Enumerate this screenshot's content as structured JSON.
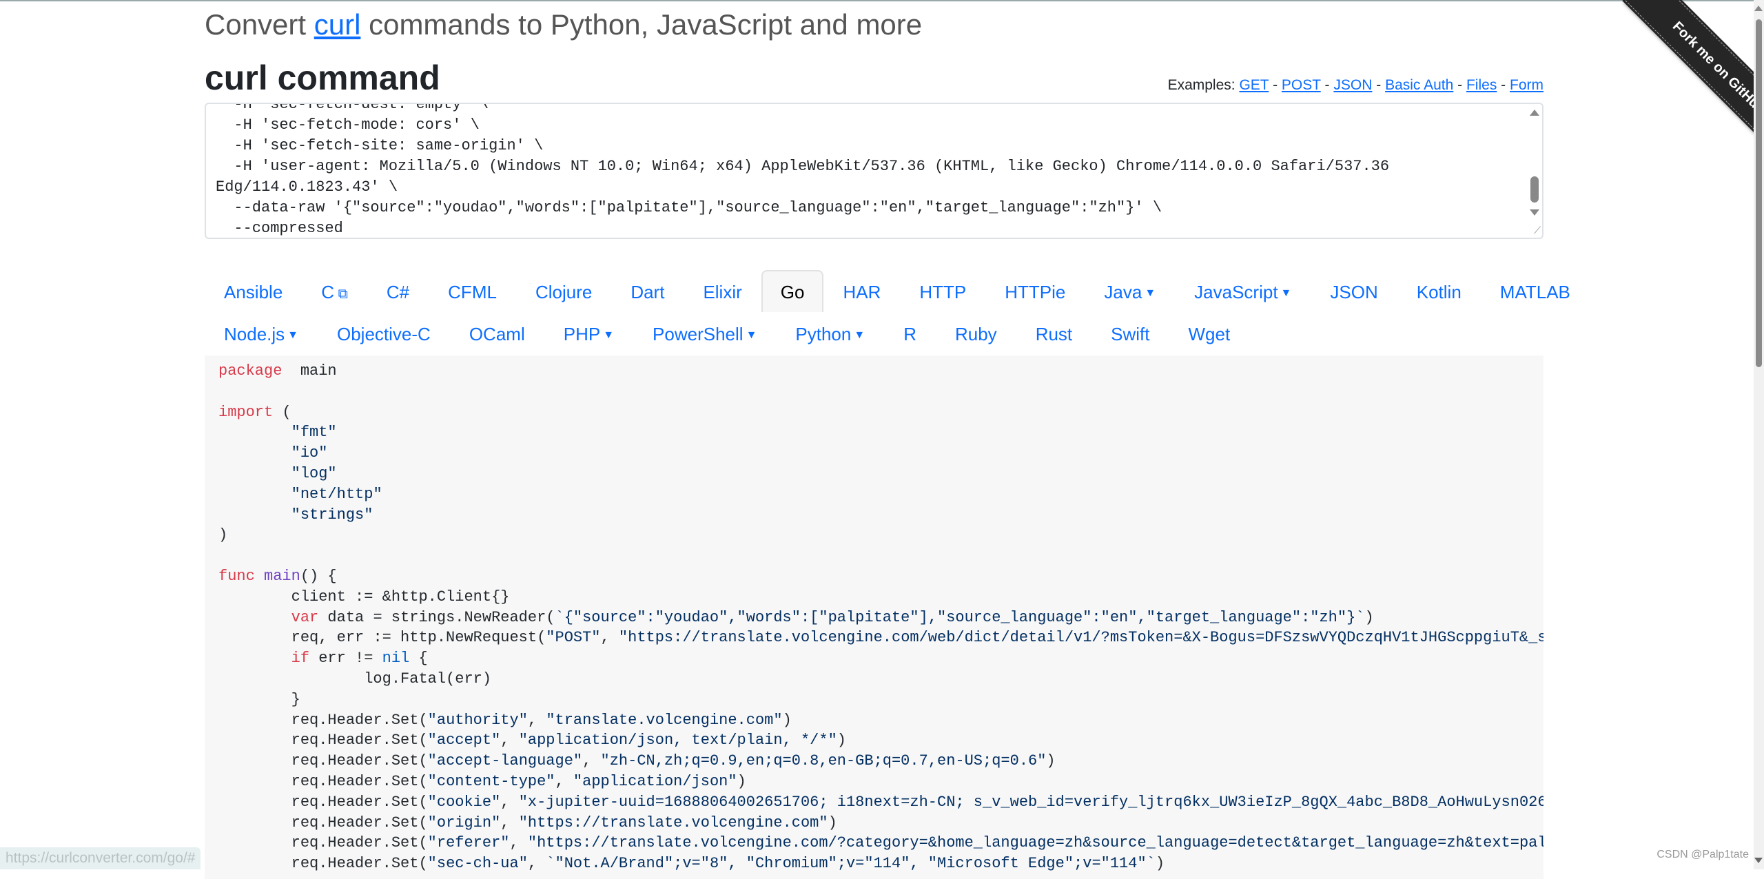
{
  "header": {
    "title_prefix": "Convert ",
    "title_link": "curl",
    "title_suffix": " commands to Python, JavaScript and more"
  },
  "curl_section": {
    "heading": "curl command",
    "examples_label": "Examples: ",
    "examples": [
      "GET",
      "POST",
      "JSON",
      "Basic Auth",
      "Files",
      "Form"
    ],
    "separator": " - ",
    "command_lines": [
      "  -H 'sec-fetch-dest: empty' \\",
      "  -H 'sec-fetch-mode: cors' \\",
      "  -H 'sec-fetch-site: same-origin' \\",
      "  -H 'user-agent: Mozilla/5.0 (Windows NT 10.0; Win64; x64) AppleWebKit/537.36 (KHTML, like Gecko) Chrome/114.0.0.0 Safari/537.36",
      "Edg/114.0.1823.43' \\",
      "  --data-raw '{\"source\":\"youdao\",\"words\":[\"palpitate\"],\"source_language\":\"en\",\"target_language\":\"zh\"}' \\",
      "  --compressed"
    ]
  },
  "languages": {
    "row1": [
      {
        "label": "Ansible"
      },
      {
        "label": "C",
        "external": true
      },
      {
        "label": "C#"
      },
      {
        "label": "CFML"
      },
      {
        "label": "Clojure"
      },
      {
        "label": "Dart"
      },
      {
        "label": "Elixir"
      },
      {
        "label": "Go",
        "active": true
      },
      {
        "label": "HAR"
      },
      {
        "label": "HTTP"
      },
      {
        "label": "HTTPie"
      },
      {
        "label": "Java",
        "dropdown": true
      },
      {
        "label": "JavaScript",
        "dropdown": true
      },
      {
        "label": "JSON"
      },
      {
        "label": "Kotlin"
      },
      {
        "label": "MATLAB"
      }
    ],
    "row2": [
      {
        "label": "Node.js",
        "dropdown": true
      },
      {
        "label": "Objective-C"
      },
      {
        "label": "OCaml"
      },
      {
        "label": "PHP",
        "dropdown": true
      },
      {
        "label": "PowerShell",
        "dropdown": true
      },
      {
        "label": "Python",
        "dropdown": true
      },
      {
        "label": "R"
      },
      {
        "label": "Ruby"
      },
      {
        "label": "Rust"
      },
      {
        "label": "Swift"
      },
      {
        "label": "Wget"
      }
    ],
    "selected": "Go"
  },
  "code_output": {
    "language": "Go",
    "lines": [
      [
        [
          "kw",
          "package"
        ],
        [
          "",
          "  main"
        ]
      ],
      [],
      [
        [
          "kw",
          "import"
        ],
        [
          "",
          " ("
        ]
      ],
      [
        [
          "",
          "\t"
        ],
        [
          "str",
          "\"fmt\""
        ]
      ],
      [
        [
          "",
          "\t"
        ],
        [
          "str",
          "\"io\""
        ]
      ],
      [
        [
          "",
          "\t"
        ],
        [
          "str",
          "\"log\""
        ]
      ],
      [
        [
          "",
          "\t"
        ],
        [
          "str",
          "\"net/http\""
        ]
      ],
      [
        [
          "",
          "\t"
        ],
        [
          "str",
          "\"strings\""
        ]
      ],
      [
        [
          "",
          ")"
        ]
      ],
      [],
      [
        [
          "kw",
          "func"
        ],
        [
          "",
          " "
        ],
        [
          "fn",
          "main"
        ],
        [
          "",
          "() {"
        ]
      ],
      [
        [
          "",
          "\tclient := &http.Client{}"
        ]
      ],
      [
        [
          "",
          "\t"
        ],
        [
          "kw",
          "var"
        ],
        [
          "",
          " data = strings.NewReader("
        ],
        [
          "str",
          "`{\"source\":\"youdao\",\"words\":[\"palpitate\"],\"source_language\":\"en\",\"target_language\":\"zh\"}`"
        ],
        [
          "",
          ")"
        ]
      ],
      [
        [
          "",
          "\treq, err := http.NewRequest("
        ],
        [
          "str",
          "\"POST\""
        ],
        [
          "",
          ", "
        ],
        [
          "str",
          "\"https://translate.volcengine.com/web/dict/detail/v1/?msToken=&X-Bogus=DFSzswVYQDczqHV1tJHGScppgiuT&_s"
        ]
      ],
      [
        [
          "",
          "\t"
        ],
        [
          "kw",
          "if"
        ],
        [
          "",
          " err != "
        ],
        [
          "con",
          "nil"
        ],
        [
          "",
          " {"
        ]
      ],
      [
        [
          "",
          "\t\tlog.Fatal(err)"
        ]
      ],
      [
        [
          "",
          "\t}"
        ]
      ],
      [
        [
          "",
          "\treq.Header.Set("
        ],
        [
          "str",
          "\"authority\""
        ],
        [
          "",
          ", "
        ],
        [
          "str",
          "\"translate.volcengine.com\""
        ],
        [
          "",
          ")"
        ]
      ],
      [
        [
          "",
          "\treq.Header.Set("
        ],
        [
          "str",
          "\"accept\""
        ],
        [
          "",
          ", "
        ],
        [
          "str",
          "\"application/json, text/plain, */*\""
        ],
        [
          "",
          ")"
        ]
      ],
      [
        [
          "",
          "\treq.Header.Set("
        ],
        [
          "str",
          "\"accept-language\""
        ],
        [
          "",
          ", "
        ],
        [
          "str",
          "\"zh-CN,zh;q=0.9,en;q=0.8,en-GB;q=0.7,en-US;q=0.6\""
        ],
        [
          "",
          ")"
        ]
      ],
      [
        [
          "",
          "\treq.Header.Set("
        ],
        [
          "str",
          "\"content-type\""
        ],
        [
          "",
          ", "
        ],
        [
          "str",
          "\"application/json\""
        ],
        [
          "",
          ")"
        ]
      ],
      [
        [
          "",
          "\treq.Header.Set("
        ],
        [
          "str",
          "\"cookie\""
        ],
        [
          "",
          ", "
        ],
        [
          "str",
          "\"x-jupiter-uuid=16888064002651706; i18next=zh-CN; s_v_web_id=verify_ljtrq6kx_UW3ieIzP_8gQX_4abc_B8D8_AoHwuLysn026"
        ]
      ],
      [
        [
          "",
          "\treq.Header.Set("
        ],
        [
          "str",
          "\"origin\""
        ],
        [
          "",
          ", "
        ],
        [
          "str",
          "\"https://translate.volcengine.com\""
        ],
        [
          "",
          ")"
        ]
      ],
      [
        [
          "",
          "\treq.Header.Set("
        ],
        [
          "str",
          "\"referer\""
        ],
        [
          "",
          ", "
        ],
        [
          "str",
          "\"https://translate.volcengine.com/?category=&home_language=zh&source_language=detect&target_language=zh&text=pal"
        ]
      ],
      [
        [
          "",
          "\treq.Header.Set("
        ],
        [
          "str",
          "\"sec-ch-ua\""
        ],
        [
          "",
          ", "
        ],
        [
          "str",
          "`\"Not.A/Brand\";v=\"8\", \"Chromium\";v=\"114\", \"Microsoft Edge\";v=\"114\"`"
        ],
        [
          "",
          ")"
        ]
      ]
    ]
  },
  "ribbon": {
    "label": "Fork me on GitHub"
  },
  "status_bar": {
    "url": "https://curlconverter.com/go/#"
  },
  "watermark": "CSDN @Palp1tate",
  "colors": {
    "link": "#0d6efd",
    "keyword": "#d73a49",
    "function": "#6f42c1",
    "string": "#032f62",
    "code_bg": "#f7f7f7"
  }
}
